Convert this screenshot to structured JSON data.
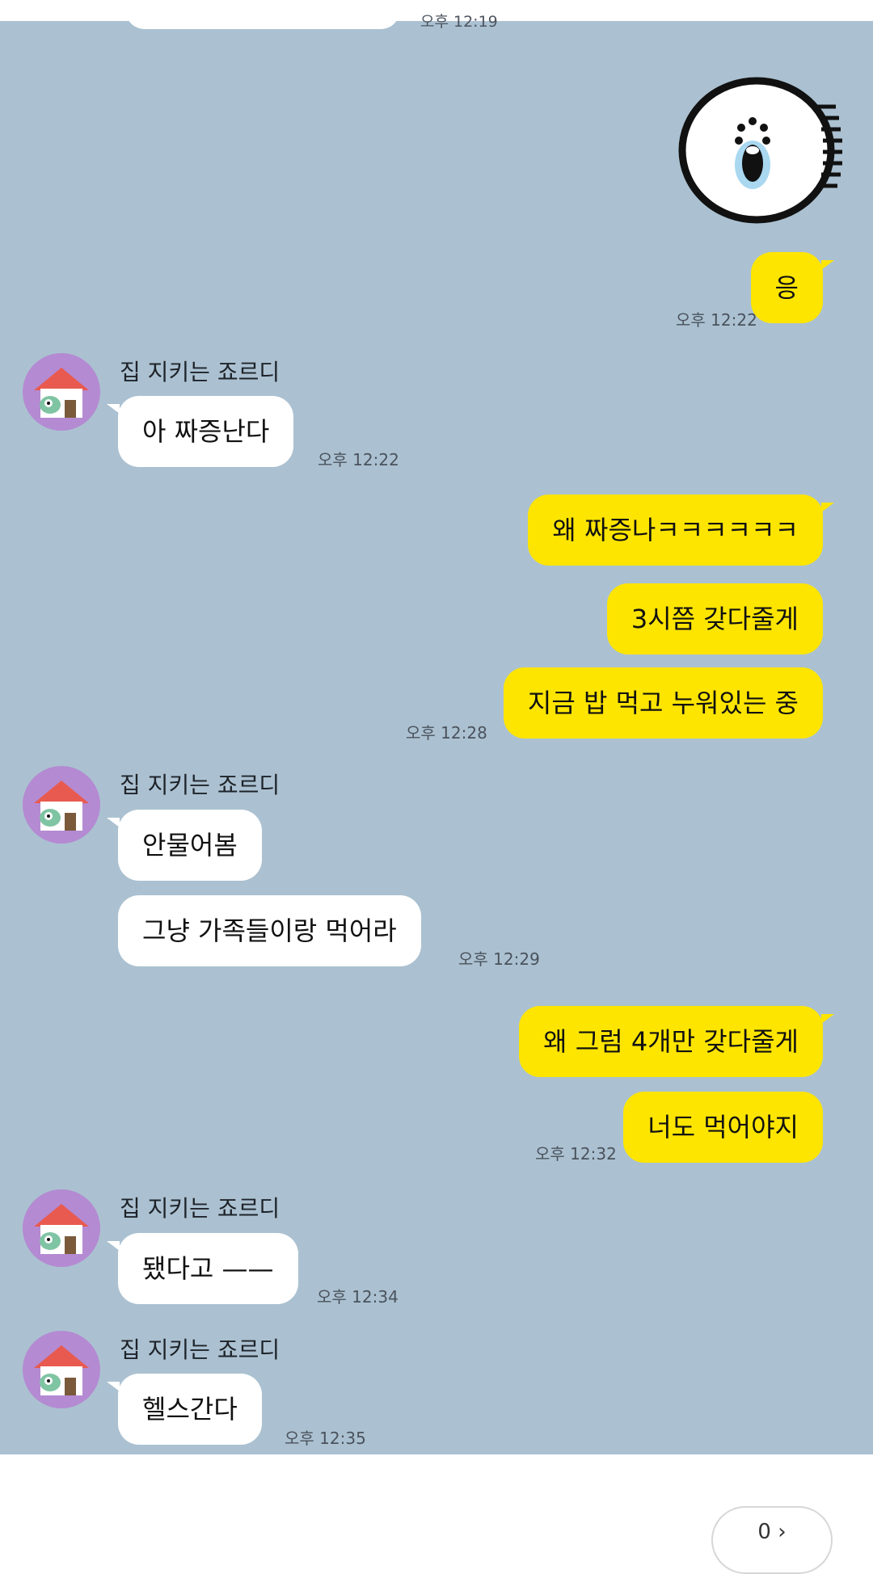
{
  "chat": {
    "top_time": "오후 12:19",
    "sender_name": "집 지키는 죠르디",
    "messages": [
      {
        "side": "out",
        "text": "응"
      },
      {
        "side": "in",
        "text": "아 짜증난다"
      },
      {
        "side": "out",
        "text": "왜 짜증나ㅋㅋㅋㅋㅋㅋ"
      },
      {
        "side": "out",
        "text": "3시쯤 갖다줄게"
      },
      {
        "side": "out",
        "text": "지금 밥 먹고 누워있는 중"
      },
      {
        "side": "in",
        "text": "안물어봄"
      },
      {
        "side": "in",
        "text": "그냥 가족들이랑 먹어라"
      },
      {
        "side": "out",
        "text": "왜 그럼 4개만 갖다줄게"
      },
      {
        "side": "out",
        "text": "너도 먹어야지"
      },
      {
        "side": "in",
        "text": "됐다고 ——"
      },
      {
        "side": "in",
        "text": "헬스간다"
      }
    ],
    "times": [
      "오후 12:22",
      "오후 12:22",
      "오후 12:28",
      "오후 12:29",
      "오후 12:32",
      "오후 12:34",
      "오후 12:35"
    ]
  },
  "bottom": {
    "pill_label": "0 ›"
  },
  "colors": {
    "chat_bg": "#abc1d1",
    "outgoing": "#fee500",
    "incoming": "#ffffff",
    "avatar_bg": "#b48ad2"
  },
  "icons": {
    "sticker": "screaming-face-sticker",
    "avatar": "jordy-doghouse-avatar"
  }
}
